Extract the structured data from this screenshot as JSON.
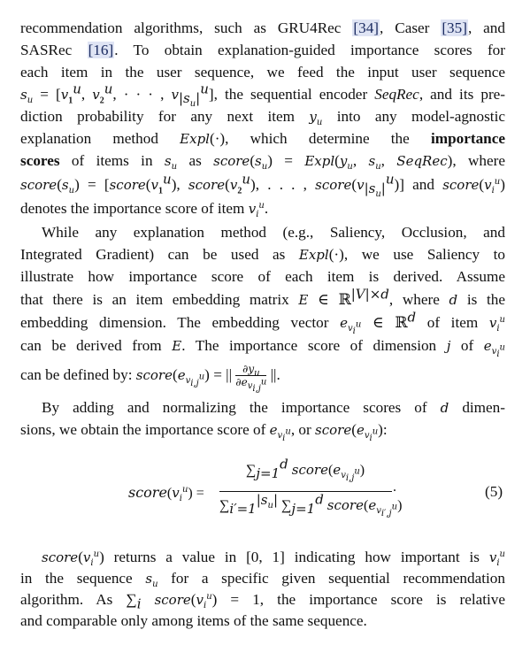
{
  "paper": {
    "lines": [
      "recommendation algorithms, such as GRU4Rec [34], Caser [35], and",
      "SASRec [16]. To obtain explanation-guided importance scores for",
      "each item in the user sequence, we feed the input user sequence"
    ],
    "cites": {
      "c34": "[34]",
      "c35": "[35]",
      "c16": "[16]"
    },
    "p1_rest": [
      "s_u = [v_1^u, v_2^u, ···, v_{|s_u|}^u], the sequential encoder SeqRec, and its pre-",
      "diction probability for any next item y_u into any model-agnostic",
      "explanation method Expl(·), which determine the importance",
      "scores of items in s_u as score(s_u) = Expl(y_u, s_u, SeqRec), where",
      "score(s_u) = [score(v_1^u), score(v_2^u), ..., score(v_{|s_u|}^u)] and score(v_i^u)",
      "denotes the importance score of item v_i^u."
    ],
    "p2": [
      "While any explanation method (e.g., Saliency, Occlusion, and",
      "Integrated Gradient) can be used as Expl(·), we use Saliency to",
      "illustrate how importance score of each item is derived. Assume",
      "that there is an item embedding matrix E ∈ ℝ^{|V|×d}, where d is the",
      "embedding dimension. The embedding vector e_{v_i^u} ∈ ℝ^d of item v_i^u",
      "can be derived from E. The importance score of dimension j of e_{v_i^u}",
      "can be defined by: score(e_{v_{i,j}^u}) = || ∂y_u / ∂e_{v_{i,j}^u} ||."
    ],
    "p3": [
      "By adding and normalizing the importance scores of d dimen-",
      "sions, we obtain the importance score of e_{v_i^u}, or score(e_{v_i^u}):"
    ],
    "equation_number": "(5)",
    "p4": [
      "score(v_i^u) returns a value in [0, 1] indicating how important is v_i^u",
      "in the sequence s_u for a specific given sequential recommendation",
      "algorithm. As Σ_i score(v_i^u) = 1, the importance score is relative",
      "and comparable only among items of the same sequence."
    ]
  }
}
